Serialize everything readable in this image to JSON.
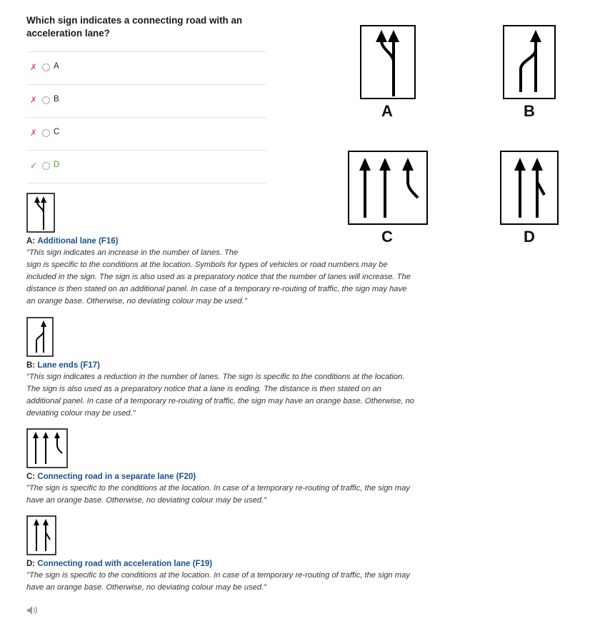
{
  "question": "Which sign indicates a connecting road with an acceleration lane?",
  "options": [
    {
      "label": "A",
      "status": "wrong",
      "mark": "✗"
    },
    {
      "label": "B",
      "status": "wrong",
      "mark": "✗"
    },
    {
      "label": "C",
      "status": "wrong",
      "mark": "✗"
    },
    {
      "label": "D",
      "status": "correct",
      "mark": "✓"
    }
  ],
  "signs": [
    {
      "caption": "A"
    },
    {
      "caption": "B"
    },
    {
      "caption": "C"
    },
    {
      "caption": "D"
    }
  ],
  "explanations": [
    {
      "letter": "A:",
      "title": "Additional lane (F16)",
      "quote_first": "\"This sign indicates an increase in the number of lanes. The",
      "quote_rest": "sign is specific to the conditions at the location. Symbols for types of vehicles or road numbers may be included in the sign. The sign is also used as a preparatory notice that the number of lanes will increase. The distance is then stated on an additional panel. In case of a temporary re-routing of traffic, the sign may have an orange base. Otherwise, no deviating colour may be used.\""
    },
    {
      "letter": "B:",
      "title": "Lane ends (F17)",
      "quote": "\"This sign indicates a reduction in the number of lanes. The sign is specific to the conditions at the location. The sign is also used as a preparatory notice that a lane is ending. The distance is then stated on an additional panel. In case of a temporary re-routing of traffic, the sign may have an orange base. Otherwise, no deviating colour may be used.\""
    },
    {
      "letter": "C:",
      "title": "Connecting road in a separate lane (F20)",
      "quote": "\"The sign is specific to the conditions at the location. In case of a temporary re-routing of traffic, the sign may have an orange base. Otherwise, no deviating colour may be used.\""
    },
    {
      "letter": "D:",
      "title": "Connecting road with acceleration lane (F19)",
      "quote": "\"The sign is specific to the conditions at the location. In case of a temporary re-routing of traffic, the sign may have an orange base. Otherwise, no deviating colour may be used.\""
    }
  ],
  "colors": {
    "wrong": "#d9534f",
    "correct": "#4b9b32",
    "link": "#1d4e8f"
  },
  "icons": {
    "audio": "speaker-icon"
  }
}
